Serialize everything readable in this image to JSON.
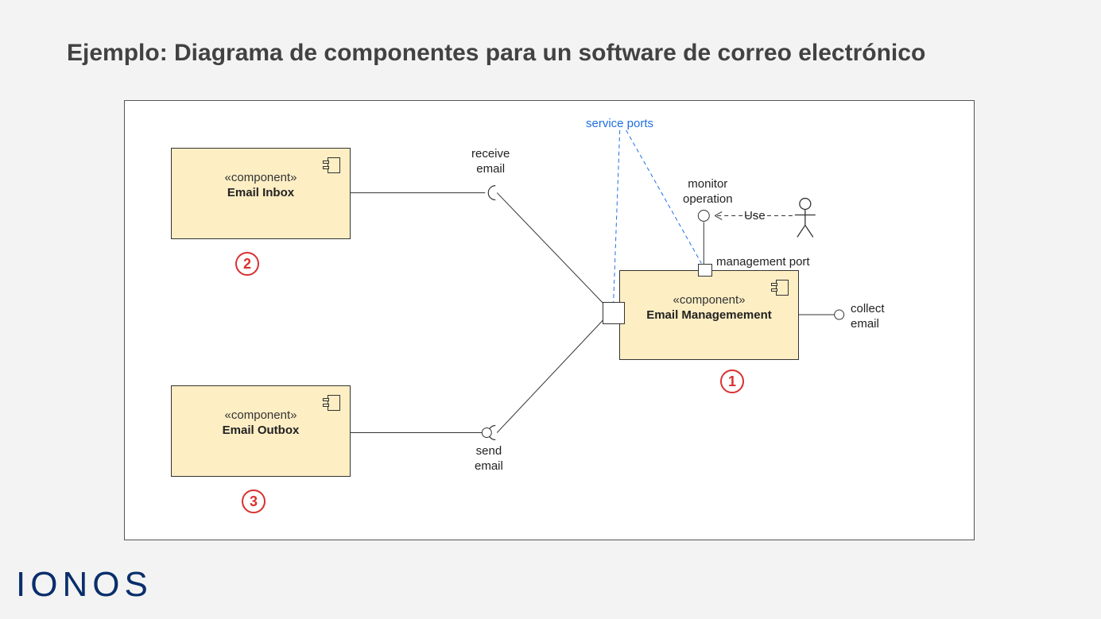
{
  "title": "Ejemplo: Diagrama de componentes para un software de correo electrónico",
  "logo": "IONOS",
  "labels": {
    "service_ports": "service ports",
    "receive_email": "receive\nemail",
    "send_email": "send\nemail",
    "collect_email": "collect\nemail",
    "monitor_operation": "monitor\noperation",
    "management_port": "management port",
    "use": "Use"
  },
  "components": {
    "inbox": {
      "stereotype": "«component»",
      "name": "Email Inbox",
      "badge": "2"
    },
    "outbox": {
      "stereotype": "«component»",
      "name": "Email Outbox",
      "badge": "3"
    },
    "management": {
      "stereotype": "«component»",
      "name": "Email Managemement",
      "badge": "1"
    }
  }
}
